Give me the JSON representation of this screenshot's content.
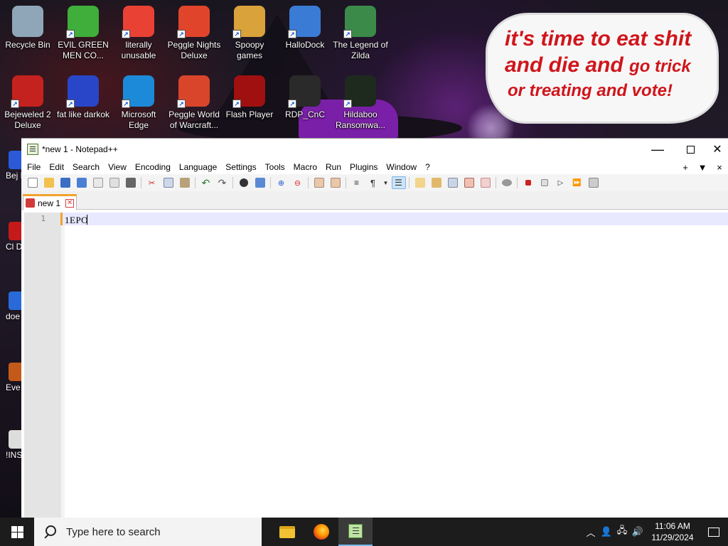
{
  "desktop": {
    "bubble": {
      "line1": "it's time to eat shit",
      "line2a": "and die and",
      "line2b": "go trick",
      "line3": "or treating and vote!",
      "text_color": "#d0151b"
    },
    "icons": [
      {
        "label": "Recycle Bin",
        "icon": "recycle-bin-icon",
        "color": "#8fa6b8"
      },
      {
        "label": "EVIL GREEN MEN CO...",
        "icon": "messenger-men-icon",
        "color": "#3fae3a"
      },
      {
        "label": "literally unusable",
        "icon": "chrome-icon",
        "color": "#e94235"
      },
      {
        "label": "Peggle Nights Deluxe",
        "icon": "peggle-icon",
        "color": "#e0452b"
      },
      {
        "label": "Spoopy games",
        "icon": "folder-icon",
        "color": "#d9a23a"
      },
      {
        "label": "HalloDock",
        "icon": "windows-shield-icon",
        "color": "#3a7bd5"
      },
      {
        "label": "The Legend of Zilda",
        "icon": "zilda-icon",
        "color": "#3c8a4a"
      },
      {
        "label": "Bejeweled 2 Deluxe",
        "icon": "bejeweled-icon",
        "color": "#c4221f"
      },
      {
        "label": "fat like darkok",
        "icon": "mpl-icon",
        "color": "#2a46c8"
      },
      {
        "label": "Microsoft Edge",
        "icon": "edge-icon",
        "color": "#1c8ad8"
      },
      {
        "label": "Peggle World of Warcraft...",
        "icon": "peggle-icon",
        "color": "#d9452b"
      },
      {
        "label": "Flash Player",
        "icon": "flash-icon",
        "color": "#a01010"
      },
      {
        "label": "RDP_CnC",
        "icon": "rdp-icon",
        "color": "#2a2a2a"
      },
      {
        "label": "Hildaboo Ransomwa...",
        "icon": "yashma-icon",
        "color": "#1e2a1e"
      }
    ],
    "side_icons": [
      {
        "label": "Bej D",
        "color": "#2a5ad8"
      },
      {
        "label": "Cl D",
        "color": "#c41a1a"
      },
      {
        "label": "doe",
        "color": "#2a6ad8"
      },
      {
        "label": "Eve",
        "color": "#c45a1a"
      },
      {
        "label": "!INST",
        "color": "#dddddd"
      }
    ]
  },
  "npp": {
    "title": "*new 1 - Notepad++",
    "menu": [
      "File",
      "Edit",
      "Search",
      "View",
      "Encoding",
      "Language",
      "Settings",
      "Tools",
      "Macro",
      "Run",
      "Plugins",
      "Window",
      "?"
    ],
    "menu_right": [
      "+",
      "▼",
      "×"
    ],
    "tab_label": "new 1",
    "line_number": "1",
    "code_text": "1EPO",
    "accent": "#f2a22c"
  },
  "taskbar": {
    "search_placeholder": "Type here to search",
    "time": "11:06 AM",
    "date": "11/29/2024"
  }
}
